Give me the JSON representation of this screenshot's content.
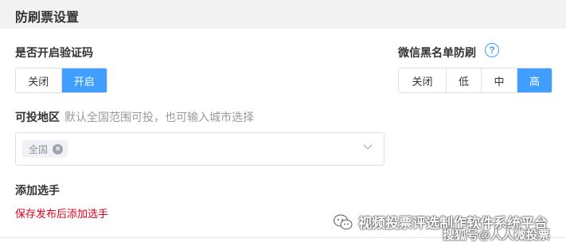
{
  "header": {
    "title": "防刷票设置"
  },
  "captcha": {
    "label": "是否开启验证码",
    "options": [
      "关闭",
      "开启"
    ],
    "selected": "开启"
  },
  "wechat_blacklist": {
    "label": "微信黑名单防刷",
    "help_icon": "question-circle-icon",
    "help_glyph": "?",
    "options": [
      "关闭",
      "低",
      "中",
      "高"
    ],
    "selected": "高"
  },
  "region": {
    "label": "可投地区",
    "hint": "默认全国范围可投，也可输入城市选择",
    "tags": [
      "全国"
    ],
    "tag_close_glyph": "×",
    "dropdown_icon": "chevron-down-icon"
  },
  "contestants": {
    "label": "添加选手",
    "note": "保存发布后添加选手"
  },
  "watermark": {
    "title": "视频投票评选制作软件系统平台",
    "subtitle": "搜狐号@人人微投票"
  },
  "colors": {
    "primary": "#409eff",
    "danger": "#e0001b",
    "header_bg": "#f2f2f2",
    "border": "#dcdfe6"
  }
}
